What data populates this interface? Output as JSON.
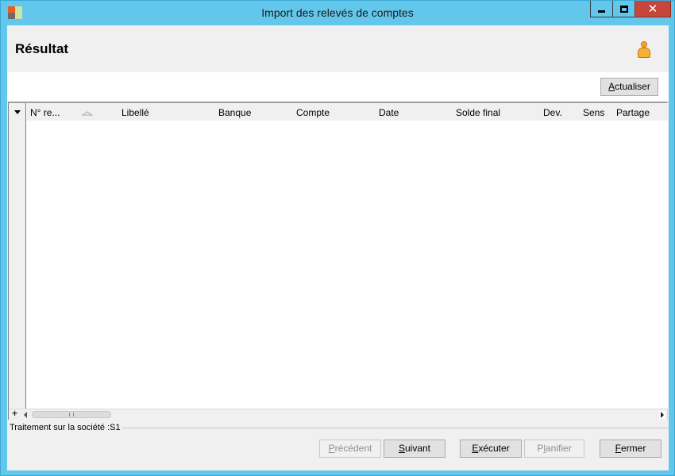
{
  "window": {
    "title": "Import des relevés de comptes",
    "close_glyph": "✕"
  },
  "header": {
    "title": "Résultat",
    "user_icon": "user-icon"
  },
  "toolbar": {
    "refresh_label_accel": "A",
    "refresh_label_rest": "ctualiser"
  },
  "grid": {
    "columns": [
      "N° re...",
      "Libellé",
      "Banque",
      "Compte",
      "Date",
      "Solde final",
      "Dev.",
      "Sens",
      "Partage"
    ],
    "add_glyph": "+"
  },
  "status": {
    "text": "Traitement sur la société :S1"
  },
  "buttons": {
    "prev_accel": "P",
    "prev_rest": "récédent",
    "next_accel": "S",
    "next_rest": "uivant",
    "exec_accel": "E",
    "exec_rest": "xécuter",
    "plan_pre": "P",
    "plan_accel": "l",
    "plan_rest": "anifier",
    "close_accel": "F",
    "close_rest": "ermer"
  }
}
